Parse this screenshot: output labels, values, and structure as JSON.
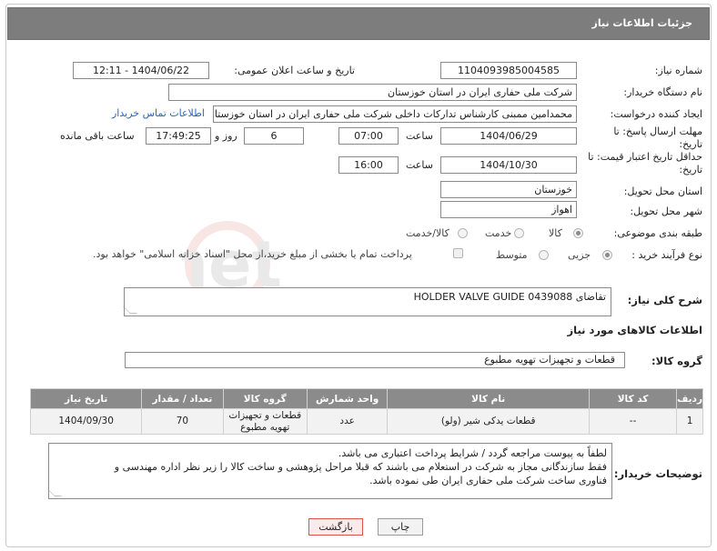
{
  "header": {
    "title": "جزئیات اطلاعات نیاز"
  },
  "fields": {
    "need_number_label": "شماره نیاز:",
    "need_number": "1104093985004585",
    "announce_label": "تاریخ و ساعت اعلان عمومی:",
    "announce_value": "1404/06/22 - 12:11",
    "buyer_label": "نام دستگاه خریدار:",
    "buyer_value": "شرکت ملی حفاری ایران در استان خوزستان",
    "creator_label": "ایجاد کننده درخواست:",
    "creator_value": "محمدامین ممبنی کارشناس تدارکات داخلی شرکت ملی حفاری ایران در استان خوزستان",
    "contact_link": "اطلاعات تماس خریدار",
    "deadline_label": "مهلت ارسال پاسخ: تا تاریخ:",
    "deadline_date": "1404/06/29",
    "hour_label": "ساعت",
    "deadline_time": "07:00",
    "days_value": "6",
    "days_label": "روز و",
    "remaining_time": "17:49:25",
    "remaining_label": "ساعت باقی مانده",
    "price_validity_label": "حداقل تاریخ اعتبار قیمت: تا تاریخ:",
    "price_validity_date": "1404/10/30",
    "price_validity_hour_label": "ساعت",
    "price_validity_time": "16:00",
    "province_label": "استان محل تحویل:",
    "province_value": "خوزستان",
    "city_label": "شهر محل تحویل:",
    "city_value": "اهواز",
    "category_label": "طبقه بندی موضوعی:",
    "category_options": [
      "کالا",
      "خدمت",
      "کالا/خدمت"
    ],
    "category_selected": "کالا",
    "process_label": "نوع فرآیند خرید :",
    "process_options": [
      "جزیی",
      "متوسط"
    ],
    "process_selected": "جزیی",
    "payment_note": "پرداخت تمام یا بخشی از مبلغ خرید،از محل \"اسناد خزانه اسلامی\" خواهد بود."
  },
  "description": {
    "label": "شرح کلی نیاز:",
    "value": "تقاضای HOLDER VALVE GUIDE 0439088"
  },
  "goods_section": {
    "title": "اطلاعات کالاهای مورد نیاز",
    "group_label": "گروه کالا:",
    "group_value": "قطعات و تجهیزات تهویه مطبوع"
  },
  "table": {
    "headers": [
      "ردیف",
      "کد کالا",
      "نام کالا",
      "واحد شمارش",
      "گروه کالا",
      "تعداد / مقدار",
      "تاریخ نیاز"
    ],
    "rows": [
      {
        "index": "1",
        "code": "--",
        "name": "قطعات یدکی شیر (ولو)",
        "unit": "عدد",
        "group_line1": "قطعات و تجهیزات",
        "group_line2": "تهویه مطبوع",
        "quantity": "70",
        "date": "1404/09/30"
      }
    ]
  },
  "buyer_notes": {
    "label": "توضیحات خریدار:",
    "line1": "لطفاً به پیوست مراجعه گردد / شرایط پرداخت اعتباری می باشد.",
    "line2": "فقط سازندگانی مجاز به شرکت در استعلام می باشند که قبلا مراحل پژوهشی و ساخت کالا را زیر نظر اداره مهندسی و",
    "line3": "فناوری ساخت شرکت ملی حفاری ایران طی نموده باشد."
  },
  "buttons": {
    "print": "چاپ",
    "back": "بازگشت"
  },
  "colors": {
    "header_bg": "#7d7d7d",
    "link": "#2a66b8",
    "table_header": "#8b8b8b",
    "back_border": "#d9534f"
  }
}
